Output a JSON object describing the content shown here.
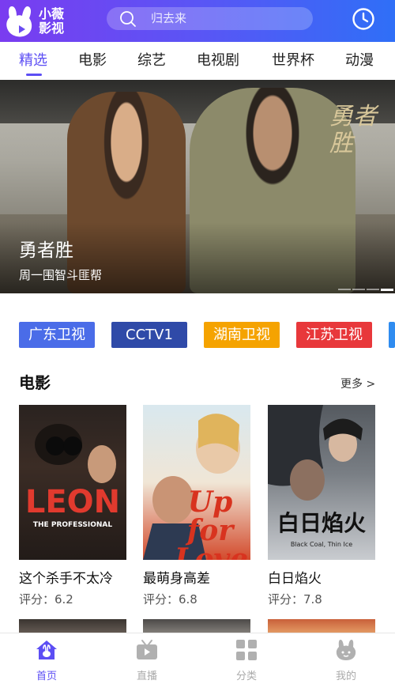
{
  "header": {
    "logo_text_line1": "小薇",
    "logo_text_line2": "影视",
    "search_placeholder": "归去来",
    "search_icon": "search-icon",
    "history_icon": "clock-icon",
    "brand_color": "#5c4ef4"
  },
  "tabs": [
    {
      "label": "精选",
      "active": true
    },
    {
      "label": "电影"
    },
    {
      "label": "综艺"
    },
    {
      "label": "电视剧"
    },
    {
      "label": "世界杯"
    },
    {
      "label": "动漫"
    }
  ],
  "banner": {
    "logo": "勇者胜",
    "title": "勇者胜",
    "subtitle": "周一围智斗匪帮",
    "slide_count": 4,
    "active_slide": 4
  },
  "channels": [
    {
      "label": "广东卫视",
      "color": "#4a6ce8"
    },
    {
      "label": "CCTV1",
      "color": "#2f4aa8"
    },
    {
      "label": "湖南卫视",
      "color": "#f5a300"
    },
    {
      "label": "江苏卫视",
      "color": "#e8383b"
    }
  ],
  "movies_section": {
    "title": "电影",
    "more_label": "更多 >",
    "items": [
      {
        "name": "这个杀手不太冷",
        "score": "评分：6.2",
        "poster_title": "LEON",
        "poster_sub": "THE PROFESSIONAL"
      },
      {
        "name": "最萌身高差",
        "score": "评分：6.8",
        "poster_title": "Up for Love"
      },
      {
        "name": "白日焰火",
        "score": "评分：7.8",
        "poster_title": "白日焰火",
        "poster_sub": "Black Coal, Thin Ice"
      }
    ]
  },
  "bottom_nav": [
    {
      "label": "首页",
      "icon": "home-icon",
      "active": true
    },
    {
      "label": "直播",
      "icon": "live-tv-icon"
    },
    {
      "label": "分类",
      "icon": "category-grid-icon"
    },
    {
      "label": "我的",
      "icon": "profile-rabbit-icon"
    }
  ]
}
